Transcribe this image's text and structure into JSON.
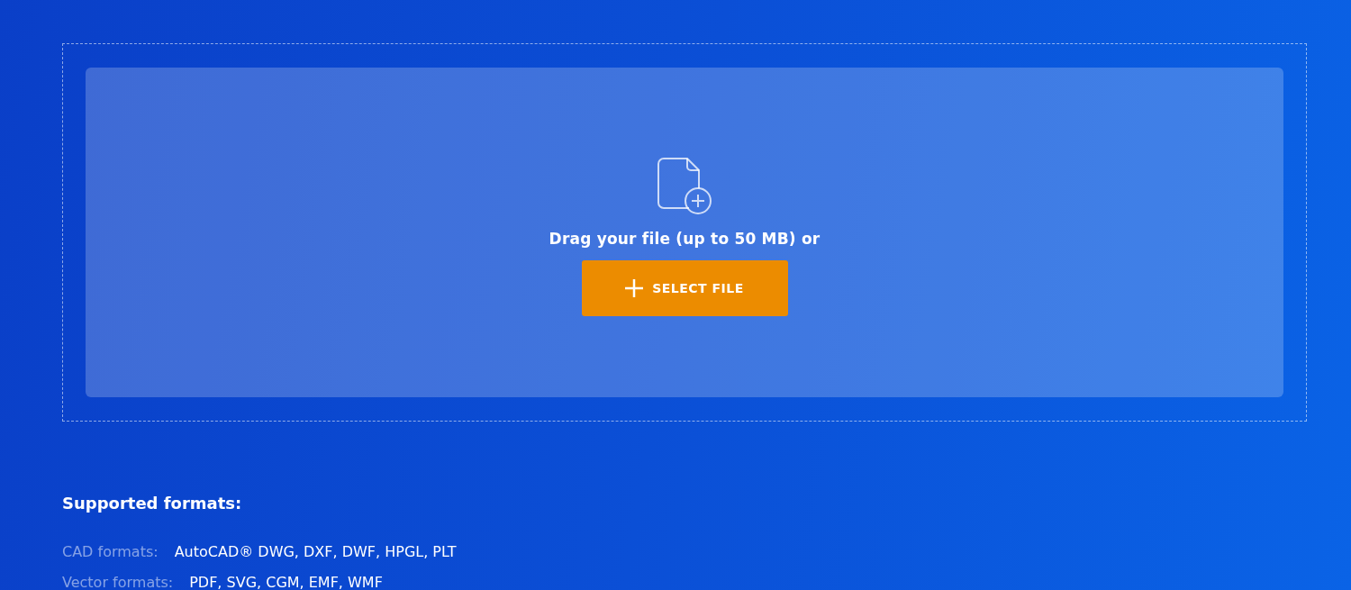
{
  "upload": {
    "prompt": "Drag your file (up to 50 MB) or",
    "button": "SELECT FILE"
  },
  "formats": {
    "heading": "Supported formats:",
    "rows": [
      {
        "label": "CAD formats:",
        "value": "AutoCAD® DWG, DXF, DWF, HPGL, PLT"
      },
      {
        "label": "Vector formats:",
        "value": "PDF, SVG, CGM, EMF, WMF"
      }
    ]
  }
}
